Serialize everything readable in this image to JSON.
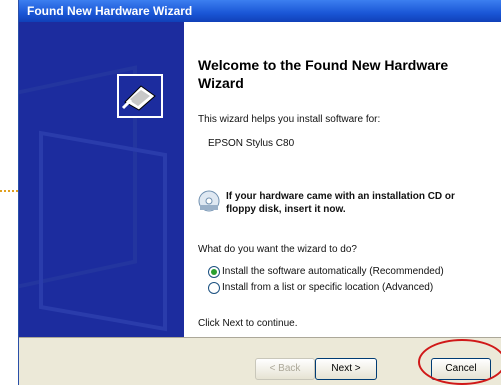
{
  "window": {
    "title": "Found New Hardware Wizard"
  },
  "wizard": {
    "heading": "Welcome to the Found New Hardware Wizard",
    "intro": "This wizard helps you install software for:",
    "device": "EPSON Stylus C80",
    "cd_prompt": "If your hardware came with an installation CD or floppy disk, insert it now.",
    "question": "What do you want the wizard to do?",
    "options": [
      {
        "label": "Install the software automatically (Recommended)",
        "selected": true
      },
      {
        "label": "Install from a list or specific location (Advanced)",
        "selected": false
      }
    ],
    "continue_hint": "Click Next to continue."
  },
  "buttons": {
    "back": "< Back",
    "next": "Next >",
    "cancel": "Cancel"
  },
  "icons": {
    "hardware": "hardware-install-icon",
    "cd": "cd-icon"
  },
  "colors": {
    "side_panel": "#1c2c9e",
    "title_bar": "#1a56d6",
    "highlight": "#d01818"
  }
}
